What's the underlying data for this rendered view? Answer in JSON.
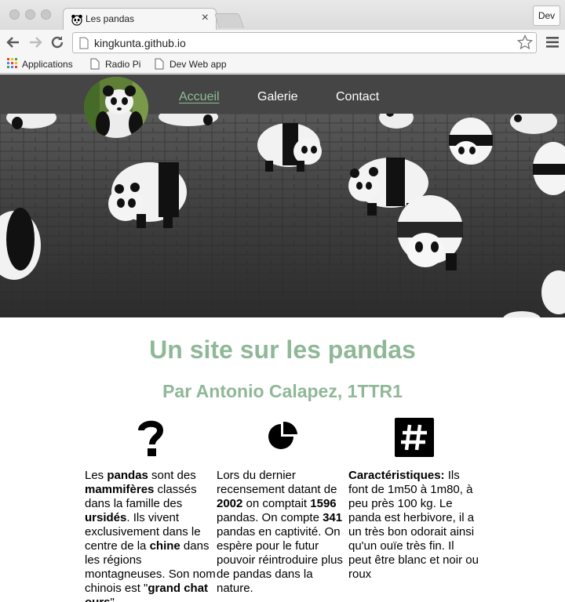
{
  "browser": {
    "tab_title": "Les pandas",
    "tab_close": "×",
    "profile": "Dev",
    "url": "kingkunta.github.io",
    "bookmarks": [
      "Applications",
      "Radio Pi",
      "Dev Web app"
    ]
  },
  "nav": {
    "items": [
      {
        "label": "Accueil",
        "active": true
      },
      {
        "label": "Galerie",
        "active": false
      },
      {
        "label": "Contact",
        "active": false
      }
    ]
  },
  "main": {
    "title": "Un site sur les pandas",
    "subtitle": "Par Antonio Calapez, 1TTR1",
    "icons": [
      "question-icon",
      "pie-chart-icon",
      "hashtag-icon"
    ],
    "columns": [
      {
        "p1": "Les ",
        "b1": "pandas",
        "p2": " sont des ",
        "b2": "mammifères",
        "p3": " classés dans la famille des ",
        "b3": "ursidés",
        "p4": ". Ils vivent exclusivement dans le centre de la ",
        "b4": "chine",
        "p5": " dans les régions montagneuses. Son nom chinois est \"",
        "b5": "grand chat ours",
        "p6": "\"."
      },
      {
        "p1": "Lors du dernier recensement datant de ",
        "b1": "2002",
        "p2": " on comptait ",
        "b2": "1596",
        "p3": " pandas. On compte ",
        "b3": "341",
        "p4": " pandas en captivité. On espère pour le futur pouvoir réintroduire plus de pandas dans la nature."
      },
      {
        "b1": "Caractéristiques:",
        "p1": " Ils font de 1m50 à 1m80, à peu près 100 kg. Le panda est herbivore, il a un très bon odorait ainsi qu'un ouïe très fin. Il peut être blanc et noir ou roux"
      }
    ]
  },
  "colors": {
    "accent": "#8fb897",
    "navbar": "#454545"
  }
}
